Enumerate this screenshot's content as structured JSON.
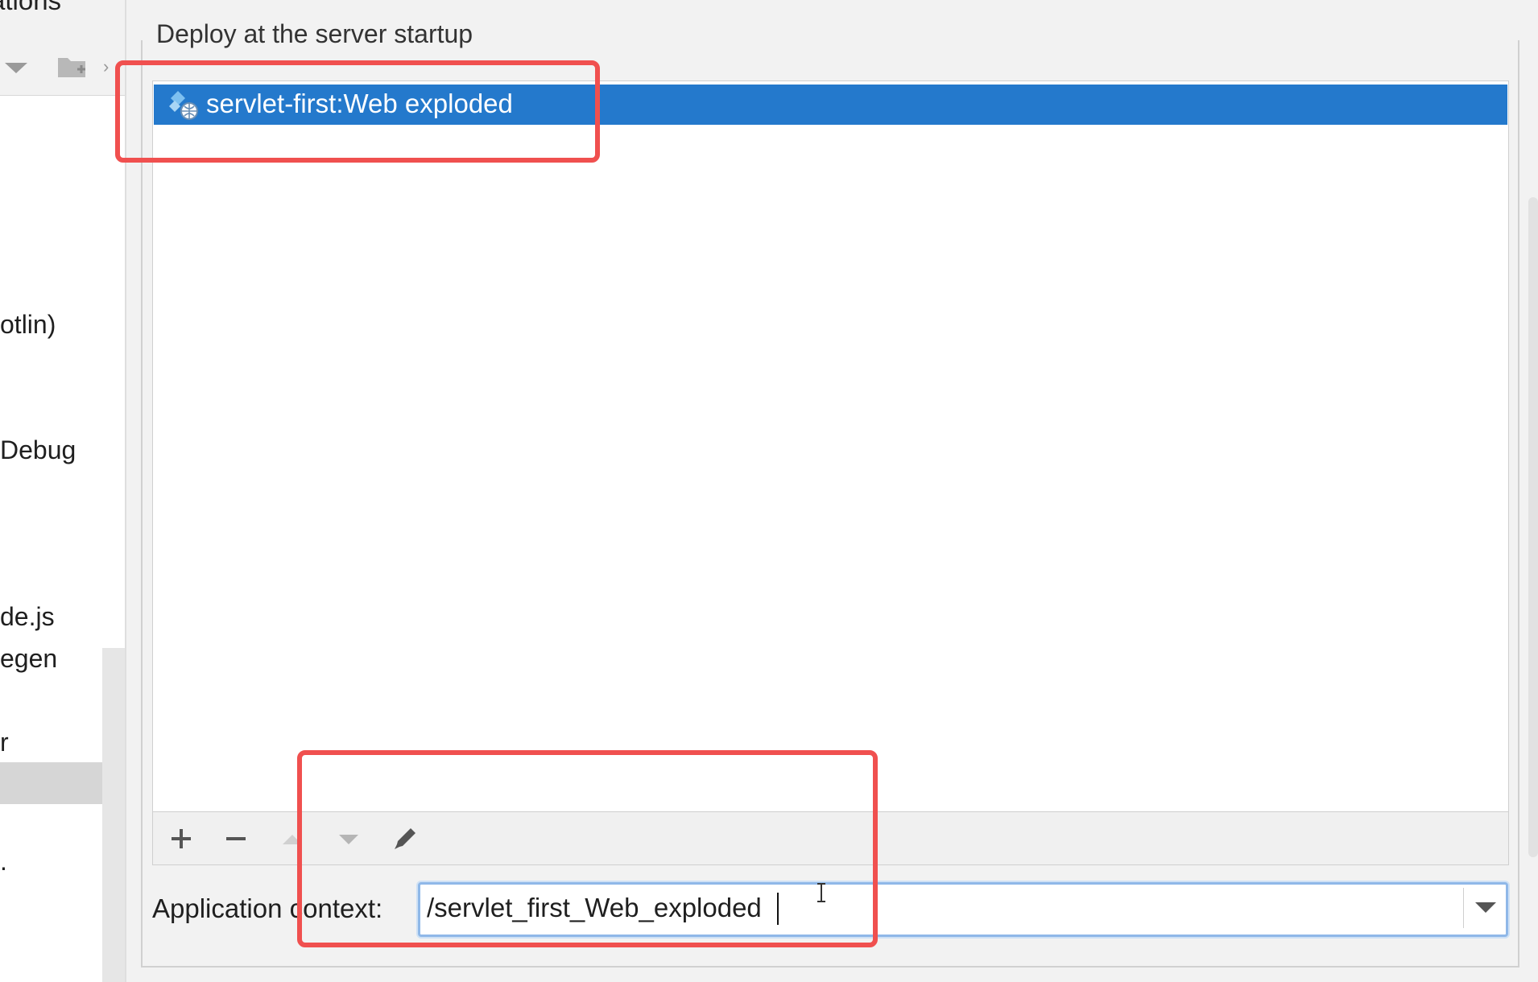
{
  "sidebar": {
    "header_text": "ations",
    "items": [
      {
        "label": "otlin)"
      },
      {
        "label": "Debug"
      },
      {
        "label": "de.js"
      },
      {
        "label": "egen"
      },
      {
        "label": "r"
      },
      {
        "label": ""
      },
      {
        "label": "."
      }
    ]
  },
  "deploy": {
    "group_title": "Deploy at the server startup",
    "artifacts": [
      {
        "label": "servlet-first:Web exploded",
        "selected": true
      }
    ]
  },
  "toolbar": {
    "buttons": [
      {
        "name": "add",
        "glyph": "+",
        "enabled": true
      },
      {
        "name": "remove",
        "glyph": "−",
        "enabled": true
      },
      {
        "name": "move-up",
        "enabled": false
      },
      {
        "name": "move-down",
        "enabled": false
      },
      {
        "name": "edit",
        "enabled": true
      }
    ]
  },
  "context": {
    "label": "Application context:",
    "value": "/servlet_first_Web_exploded"
  },
  "colors": {
    "selection": "#2479cc",
    "highlight_box": "#f0504f",
    "focus_border": "#8fb8e8"
  }
}
